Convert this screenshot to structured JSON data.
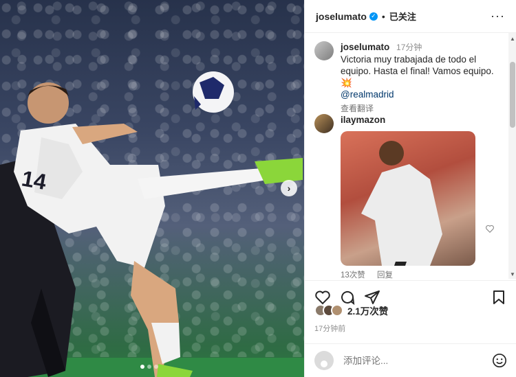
{
  "post": {
    "username": "joselumato",
    "follow_state": "已关注",
    "separator": "•",
    "more": "···"
  },
  "caption": {
    "username": "joselumato",
    "time": "17分钟",
    "text": "Victoria muy trabajada de todo el equipo. Hasta el final! Vamos equipo. 💥",
    "mention": "@realmadrid",
    "translate": "查看翻译"
  },
  "comment": {
    "username": "ilaymazon",
    "likes": "13次赞",
    "reply": "回复"
  },
  "media": {
    "next": "›",
    "slide_count": 3,
    "active_slide": 1
  },
  "engagement": {
    "likes": "2.1万次赞",
    "time": "17分钟前"
  },
  "composer": {
    "placeholder": "添加评论..."
  },
  "colors": {
    "verified": "#0095f6",
    "mention": "#00376b"
  }
}
